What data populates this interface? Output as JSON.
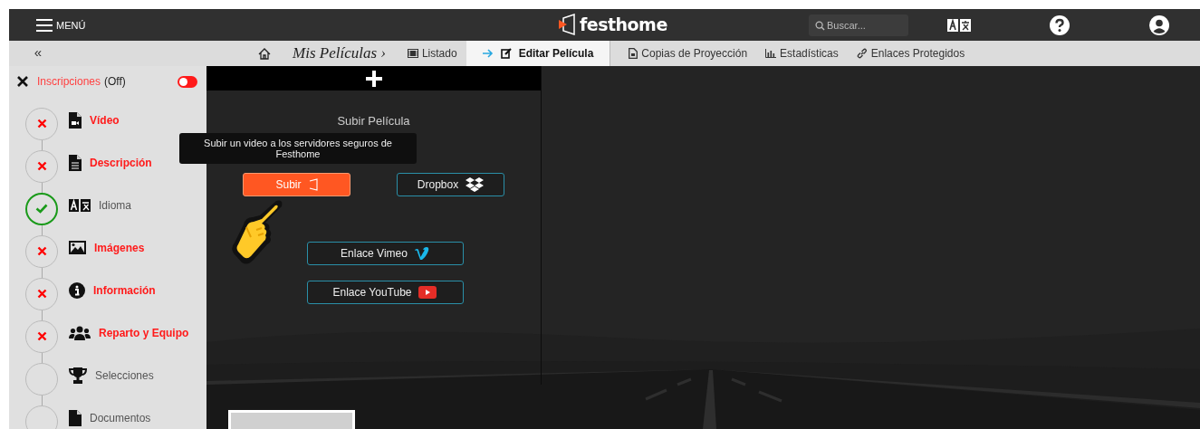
{
  "header": {
    "menu_label": "MENÚ",
    "logo_text": "festhome",
    "search": {
      "placeholder": "Buscar..."
    }
  },
  "nav": {
    "collapse": "«",
    "breadcrumb": "Mis Películas ›",
    "tabs": [
      {
        "label": "Listado",
        "selected": false
      },
      {
        "label": "Editar Película",
        "selected": true
      },
      {
        "label": "Copias de Proyección",
        "selected": false
      },
      {
        "label": "Estadísticas",
        "selected": false
      },
      {
        "label": "Enlaces Protegidos",
        "selected": false
      }
    ]
  },
  "sidebar": {
    "title": "Inscripciones",
    "state_text": "(Off)",
    "toggle": {
      "on": false
    },
    "steps": [
      {
        "label": "Vídeo",
        "error": true,
        "checked": false
      },
      {
        "label": "Descripción",
        "error": true,
        "checked": false
      },
      {
        "label": "Idioma",
        "error": false,
        "checked": true
      },
      {
        "label": "Imágenes",
        "error": true,
        "checked": false
      },
      {
        "label": "Información",
        "error": true,
        "checked": false
      },
      {
        "label": "Reparto y Equipo",
        "error": true,
        "checked": false
      },
      {
        "label": "Selecciones",
        "error": false,
        "checked": false
      },
      {
        "label": "Documentos",
        "error": false,
        "checked": false
      }
    ]
  },
  "upload": {
    "title": "Subir Película",
    "tooltip": "Subir un video a los servidores seguros de Festhome",
    "buttons": [
      {
        "label": "Subir",
        "kind": "primary"
      },
      {
        "label": "Dropbox",
        "kind": "outline"
      },
      {
        "label": "Enlace Vimeo",
        "kind": "outline"
      },
      {
        "label": "Enlace YouTube",
        "kind": "outline"
      }
    ]
  }
}
